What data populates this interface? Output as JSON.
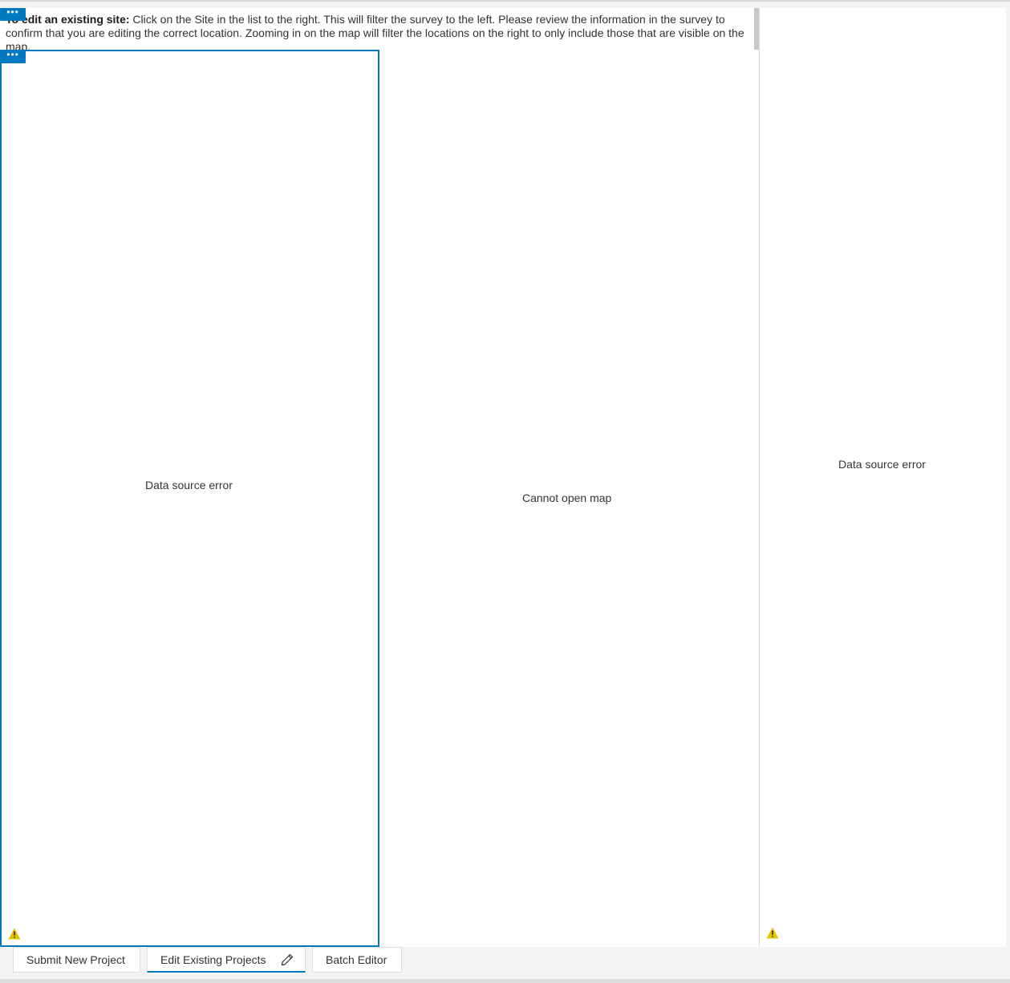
{
  "text_widget": {
    "bold_lead": "To edit an existing site:",
    "body": " Click on the Site in the list to the right. This will filter the survey to the left. Please review the information in the survey to confirm that you are editing the correct location. Zooming in on the map will filter the locations on the right to only include those that are visible on the map."
  },
  "more_badge": {
    "label": "•••"
  },
  "panels": {
    "left": {
      "message": "Data source error"
    },
    "map": {
      "message": "Cannot open map"
    },
    "right": {
      "message": "Data source error"
    }
  },
  "tabs": [
    {
      "label": "Submit New Project",
      "active": false
    },
    {
      "label": "Edit Existing Projects",
      "active": true
    },
    {
      "label": "Batch Editor",
      "active": false
    }
  ],
  "colors": {
    "accent": "#0079c1",
    "warning": "#e5c400"
  },
  "icons": {
    "warning": "warning-triangle-icon",
    "edit": "pencil-icon",
    "more": "ellipsis-icon"
  }
}
